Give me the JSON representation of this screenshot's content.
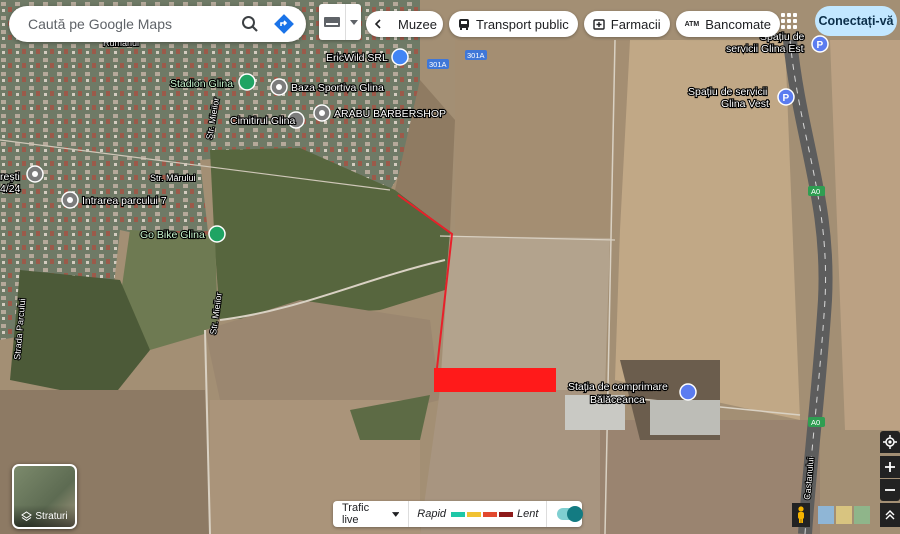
{
  "search": {
    "placeholder": "Caută pe Google Maps"
  },
  "chips": {
    "museums": "Muzee",
    "transit": "Transport public",
    "pharmacies": "Farmacii",
    "atms": "Bancomate",
    "atm_badge": "ATM"
  },
  "account": {
    "sign_in_label": "Conectați-vă"
  },
  "layers": {
    "label": "Straturi"
  },
  "traffic": {
    "label": "Trafic live",
    "fast": "Rapid",
    "slow": "Lent",
    "colors": [
      "#1fc7a7",
      "#f1c232",
      "#e2492f",
      "#8e1a1a"
    ]
  },
  "places": [
    {
      "name": "Stadion Glina",
      "icon": "stadium-pin"
    },
    {
      "name": "Baza Sportiva Glina",
      "icon": "place-pin"
    },
    {
      "name": "Cimitirul Glina",
      "icon": "cemetery-pin"
    },
    {
      "name": "ARABU BARBERSHOP",
      "icon": "place-pin"
    },
    {
      "name": "EricWild SRL",
      "icon": "shop-pin"
    },
    {
      "name": "Intrarea parcului 7",
      "icon": "place-pin"
    },
    {
      "name": "Go Bike Glina",
      "icon": "bike-pin"
    },
    {
      "name": "Stația de comprimare",
      "icon": "industry-pin"
    },
    {
      "name": "Bălăceanca",
      "icon": ""
    },
    {
      "name": "Spațiu de",
      "icon": "parking-pin"
    },
    {
      "name": "servicii Glina Est",
      "icon": ""
    },
    {
      "name": "Spațiu de servicii",
      "icon": "parking-pin"
    },
    {
      "name": "Glina Vest",
      "icon": ""
    }
  ],
  "streets": [
    "Str. Mărului",
    "Str. Mieilor",
    "Str. Mieilor",
    "Strada Parcului",
    "Rumanul",
    "Castanului"
  ],
  "road_shields": [
    "301A",
    "301A",
    "A0",
    "A0"
  ],
  "edge_labels": [
    "rești",
    "4/24"
  ],
  "colors": {
    "marked_area": "#ff1a1a",
    "route_line": "#e8202a",
    "parking": "#5b7cf0",
    "green_pin": "#1fa463"
  }
}
